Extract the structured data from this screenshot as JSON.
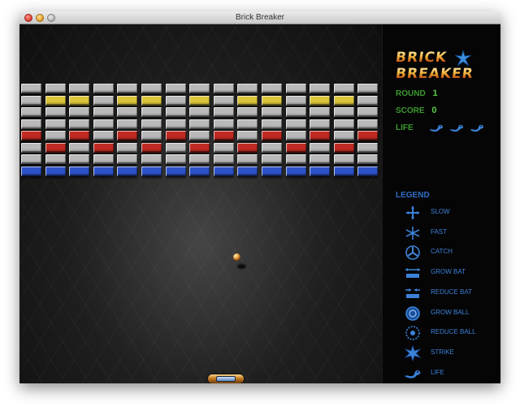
{
  "window": {
    "title": "Brick Breaker"
  },
  "colors": {
    "gray": "#b9b9b9",
    "yellow": "#d9c43a",
    "red": "#c02a22",
    "blue": "#2d53c9"
  },
  "bricks": {
    "rows": [
      [
        "gray",
        "gray",
        "gray",
        "gray",
        "gray",
        "gray",
        "gray",
        "gray",
        "gray",
        "gray",
        "gray",
        "gray",
        "gray",
        "gray",
        "gray"
      ],
      [
        "gray",
        "yellow",
        "yellow",
        "gray",
        "yellow",
        "yellow",
        "gray",
        "yellow",
        "gray",
        "yellow",
        "yellow",
        "gray",
        "yellow",
        "yellow",
        "gray"
      ],
      [
        "gray",
        "gray",
        "gray",
        "gray",
        "gray",
        "gray",
        "gray",
        "gray",
        "gray",
        "gray",
        "gray",
        "gray",
        "gray",
        "gray",
        "gray"
      ],
      [
        "gray",
        "gray",
        "gray",
        "gray",
        "gray",
        "gray",
        "gray",
        "gray",
        "gray",
        "gray",
        "gray",
        "gray",
        "gray",
        "gray",
        "gray"
      ],
      [
        "red",
        "gray",
        "red",
        "gray",
        "red",
        "gray",
        "red",
        "gray",
        "red",
        "gray",
        "red",
        "gray",
        "red",
        "gray",
        "red"
      ],
      [
        "gray",
        "red",
        "gray",
        "red",
        "gray",
        "red",
        "gray",
        "red",
        "gray",
        "red",
        "gray",
        "red",
        "gray",
        "red",
        "gray"
      ],
      [
        "gray",
        "gray",
        "gray",
        "gray",
        "gray",
        "gray",
        "gray",
        "gray",
        "gray",
        "gray",
        "gray",
        "gray",
        "gray",
        "gray",
        "gray"
      ],
      [
        "blue",
        "blue",
        "blue",
        "blue",
        "blue",
        "blue",
        "blue",
        "blue",
        "blue",
        "blue",
        "blue",
        "blue",
        "blue",
        "blue",
        "blue"
      ]
    ]
  },
  "logo": {
    "line1": "BRICK",
    "line2": "BREAKER"
  },
  "stats": {
    "round_label": "ROUND",
    "round_value": "1",
    "score_label": "SCORE",
    "score_value": "0",
    "life_label": "LIFE",
    "life_count": 3
  },
  "legend": {
    "title": "LEGEND",
    "items": [
      {
        "icon": "slow-icon",
        "label": "SLOW"
      },
      {
        "icon": "fast-icon",
        "label": "FAST"
      },
      {
        "icon": "catch-icon",
        "label": "CATCH"
      },
      {
        "icon": "grow-bat-icon",
        "label": "GROW BAT"
      },
      {
        "icon": "reduce-bat-icon",
        "label": "REDUCE BAT"
      },
      {
        "icon": "grow-ball-icon",
        "label": "GROW BALL"
      },
      {
        "icon": "reduce-ball-icon",
        "label": "REDUCE BALL"
      },
      {
        "icon": "strike-icon",
        "label": "STRIKE"
      },
      {
        "icon": "life-icon",
        "label": "LIFE"
      }
    ]
  }
}
